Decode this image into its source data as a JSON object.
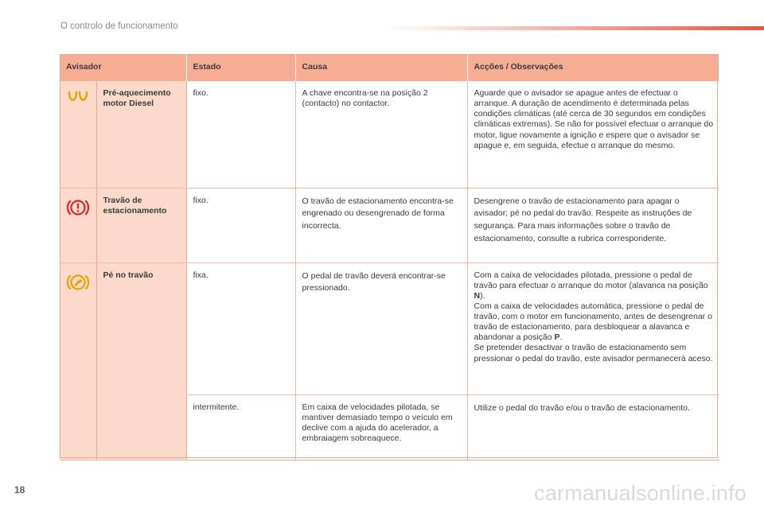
{
  "header": {
    "title": "O controlo de funcionamento"
  },
  "page_number": "18",
  "watermark": "carmanualsonline.info",
  "table": {
    "columns": [
      "Avisador",
      "Estado",
      "Causa",
      "Acções / Observações"
    ],
    "rows": [
      {
        "icon": "glow-plug-icon",
        "name": "Pré-aquecimento motor Diesel",
        "estado": "fixo.",
        "causa": "A chave encontra-se na posição 2 (contacto) no contactor.",
        "accoes": "Aguarde que o avisador se apague antes de efectuar o arranque. A duração de acendimento é determinada pelas condições climáticas (até cerca de 30 segundos em condições climáticas extremas). Se não for possível efectuar o arranque do motor, ligue novamente a ignição e espere que o avisador se apague e, em seguida, efectue o arranque do mesmo."
      },
      {
        "icon": "parking-brake-icon",
        "name": "Travão de estacionamento",
        "estado": "fixo.",
        "causa": "O travão de estacionamento encontra-se engrenado ou desengrenado de forma incorrecta.",
        "accoes": "Desengrene o travão de estacionamento para apagar o avisador; pé no pedal do travão. Respeite as instruções de segurança. Para mais informações sobre o travão de estacionamento, consulte a rubrica correspondente."
      },
      {
        "icon": "foot-on-brake-icon",
        "name": "Pé no travão",
        "estado": "fixa.",
        "causa": "O pedal de travão deverá encontrar-se pressionado.",
        "accoes_1": "Com a caixa de velocidades pilotada, pressione o pedal de travão para efectuar o arranque do motor (alavanca na posição ",
        "accoes_1_bold": "N",
        "accoes_1_end": ").",
        "accoes_2": "Com a caixa de velocidades automática, pressione o pedal de travão, com o motor em funcionamento, antes de desengrenar o travão de estacionamento, para desbloquear a alavanca e abandonar a posição ",
        "accoes_2_bold": "P",
        "accoes_2_end": ".",
        "accoes_3": "Se pretender desactivar o travão de estacionamento sem pressionar o pedal do travão, este avisador permanecerá aceso."
      },
      {
        "estado": "intermitente.",
        "causa": "Em caixa de velocidades pilotada, se mantiver demasiado tempo o veículo em declive com a ajuda do acelerador, a embraiagem sobreaquece.",
        "accoes": "Utilize o pedal do travão e/ou o travão de estacionamento."
      }
    ]
  },
  "colors": {
    "header_row": "#f6ad94",
    "first_columns": "#fcd9cb",
    "glow_plug": "#e8a200",
    "parking_brake": "#d8262c",
    "foot_brake": "#e8a200",
    "header_bar": "#e8563c"
  }
}
